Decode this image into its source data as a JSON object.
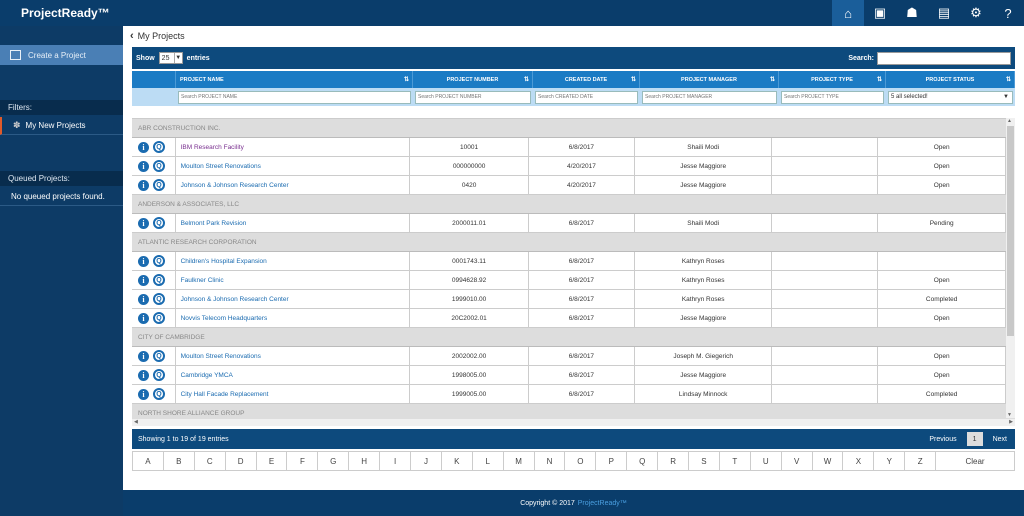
{
  "app": {
    "title": "ProjectReady™"
  },
  "topnav": {
    "icons": [
      {
        "name": "home-icon",
        "glyph": "⌂"
      },
      {
        "name": "presentation-icon",
        "glyph": "▣"
      },
      {
        "name": "user-card-icon",
        "glyph": "☗"
      },
      {
        "name": "reports-icon",
        "glyph": "▤"
      },
      {
        "name": "gear-icon",
        "glyph": "⚙"
      },
      {
        "name": "help-icon",
        "glyph": "?"
      }
    ]
  },
  "sidebar": {
    "create_label": "Create a Project",
    "filters_label": "Filters:",
    "filter_item": "My New Projects",
    "queued_label": "Queued Projects:",
    "queued_empty": "No queued projects found."
  },
  "breadcrumb": {
    "title": "My Projects"
  },
  "controls": {
    "show_label": "Show",
    "entries_value": "25",
    "entries_label": "entries",
    "search_label": "Search:"
  },
  "table": {
    "headers": [
      "PROJECT NAME",
      "PROJECT NUMBER",
      "CREATED DATE",
      "PROJECT MANAGER",
      "PROJECT TYPE",
      "PROJECT STATUS"
    ],
    "filters": {
      "name": "Search PROJECT NAME",
      "number": "Search PROJECT NUMBER",
      "date": "Search CREATED DATE",
      "manager": "Search PROJECT MANAGER",
      "type": "Search PROJECT TYPE",
      "status": "5 all selected!"
    },
    "rows": [
      {
        "group": "ABR CONSTRUCTION INC."
      },
      {
        "name": "IBM Research Facility",
        "number": "10001",
        "date": "6/8/2017",
        "manager": "Shaili Modi",
        "type": "",
        "status": "Open",
        "visited": true
      },
      {
        "name": "Moulton Street Renovations",
        "number": "000000000",
        "date": "4/20/2017",
        "manager": "Jesse Maggiore",
        "type": "",
        "status": "Open"
      },
      {
        "name": "Johnson & Johnson Research Center",
        "number": "0420",
        "date": "4/20/2017",
        "manager": "Jesse Maggiore",
        "type": "",
        "status": "Open"
      },
      {
        "group": "ANDERSON & ASSOCIATES, LLC"
      },
      {
        "name": "Belmont Park Revision",
        "number": "2000011.01",
        "date": "6/8/2017",
        "manager": "Shaili Modi",
        "type": "",
        "status": "Pending"
      },
      {
        "group": "ATLANTIC RESEARCH CORPORATION"
      },
      {
        "name": "Children's Hospital Expansion",
        "number": "0001743.11",
        "date": "6/8/2017",
        "manager": "Kathryn Roses",
        "type": "",
        "status": ""
      },
      {
        "name": "Faulkner Clinic",
        "number": "0994628.92",
        "date": "6/8/2017",
        "manager": "Kathryn Roses",
        "type": "",
        "status": "Open"
      },
      {
        "name": "Johnson & Johnson Research Center",
        "number": "1999010.00",
        "date": "6/8/2017",
        "manager": "Kathryn Roses",
        "type": "",
        "status": "Completed"
      },
      {
        "name": "Novvis Telecom Headquarters",
        "number": "20C2002.01",
        "date": "6/8/2017",
        "manager": "Jesse Maggiore",
        "type": "",
        "status": "Open"
      },
      {
        "group": "CITY OF CAMBRIDGE"
      },
      {
        "name": "Moulton Street Renovations",
        "number": "2002002.00",
        "date": "6/8/2017",
        "manager": "Joseph M. Giegerich",
        "type": "",
        "status": "Open"
      },
      {
        "name": "Cambridge YMCA",
        "number": "1998005.00",
        "date": "6/8/2017",
        "manager": "Jesse Maggiore",
        "type": "",
        "status": "Open"
      },
      {
        "name": "City Hall Facade Replacement",
        "number": "1999005.00",
        "date": "6/8/2017",
        "manager": "Lindsay Minnock",
        "type": "",
        "status": "Completed"
      },
      {
        "group": "NORTH SHORE ALLIANCE GROUP"
      }
    ]
  },
  "footer_bar": {
    "showing": "Showing 1 to 19 of 19 entries",
    "previous": "Previous",
    "page": "1",
    "next": "Next"
  },
  "alphabet": [
    "A",
    "B",
    "C",
    "D",
    "E",
    "F",
    "G",
    "H",
    "I",
    "J",
    "K",
    "L",
    "M",
    "N",
    "O",
    "P",
    "Q",
    "R",
    "S",
    "T",
    "U",
    "V",
    "W",
    "X",
    "Y",
    "Z"
  ],
  "alphabet_clear": "Clear",
  "page_footer": {
    "copyright": "Copyright © 2017",
    "brand": "ProjectReady™"
  }
}
